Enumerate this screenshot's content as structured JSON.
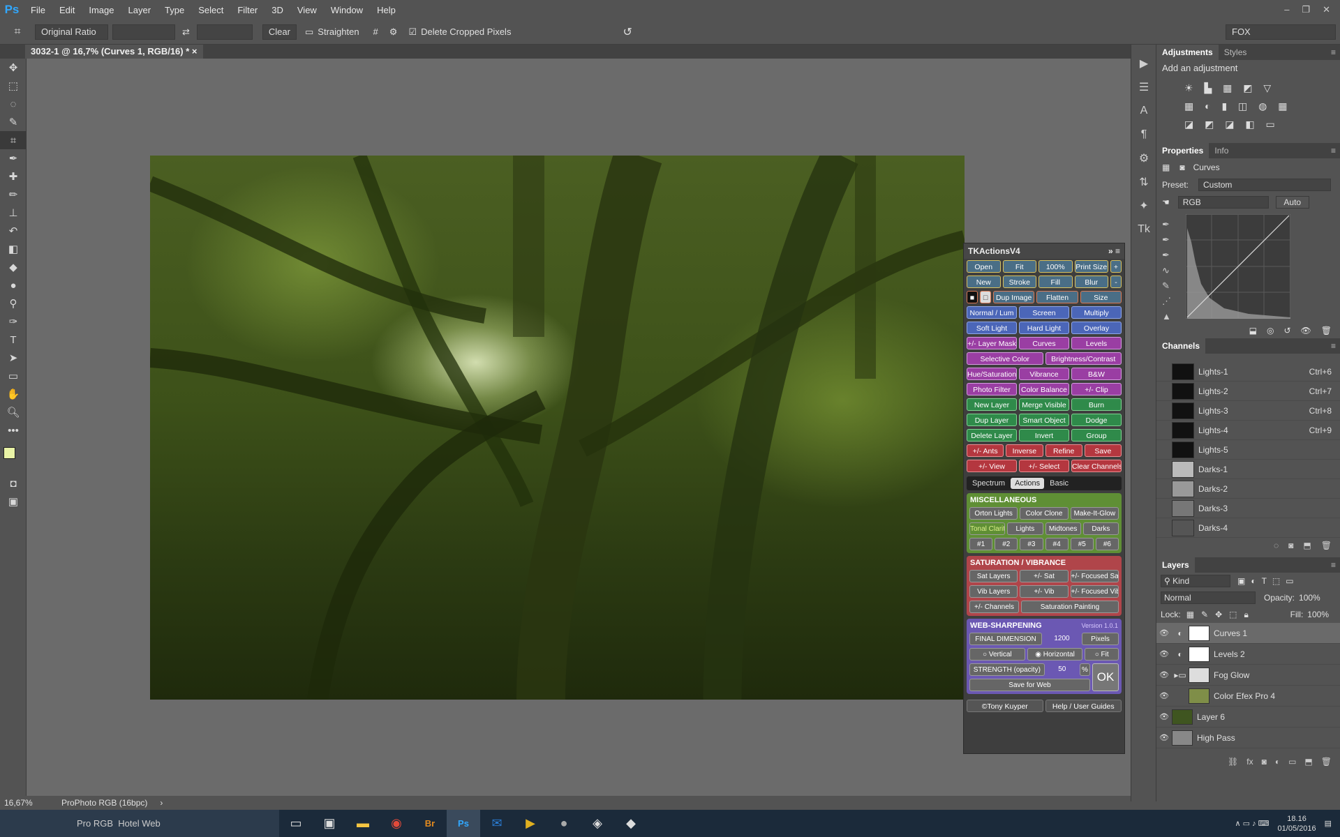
{
  "app": {
    "logo": "Ps"
  },
  "menu": [
    "File",
    "Edit",
    "Image",
    "Layer",
    "Type",
    "Select",
    "Filter",
    "3D",
    "View",
    "Window",
    "Help"
  ],
  "options": {
    "ratio": "Original Ratio",
    "clear": "Clear",
    "straighten": "Straighten",
    "delete_cropped": "Delete Cropped Pixels",
    "workspace": "FOX"
  },
  "document": {
    "tab": "3032-1 @ 16,7% (Curves 1, RGB/16) *",
    "zoom": "16,67%",
    "profile": "ProPhoto RGB (16bpc)"
  },
  "adjustments": {
    "tab1": "Adjustments",
    "tab2": "Styles",
    "hint": "Add an adjustment"
  },
  "properties": {
    "tab1": "Properties",
    "tab2": "Info",
    "type": "Curves",
    "preset_label": "Preset:",
    "preset": "Custom",
    "channel": "RGB",
    "auto": "Auto"
  },
  "channels": {
    "title": "Channels",
    "rows": [
      {
        "name": "Lights-1",
        "sc": "Ctrl+6"
      },
      {
        "name": "Lights-2",
        "sc": "Ctrl+7"
      },
      {
        "name": "Lights-3",
        "sc": "Ctrl+8"
      },
      {
        "name": "Lights-4",
        "sc": "Ctrl+9"
      },
      {
        "name": "Lights-5",
        "sc": ""
      },
      {
        "name": "Darks-1",
        "sc": ""
      },
      {
        "name": "Darks-2",
        "sc": ""
      },
      {
        "name": "Darks-3",
        "sc": ""
      },
      {
        "name": "Darks-4",
        "sc": ""
      }
    ]
  },
  "layers": {
    "title": "Layers",
    "kind": "Kind",
    "blend": "Normal",
    "opacity_label": "Opacity:",
    "opacity": "100%",
    "lock_label": "Lock:",
    "fill_label": "Fill:",
    "fill": "100%",
    "rows": [
      "Curves 1",
      "Levels 2",
      "Fog Glow",
      "Color Efex Pro 4",
      "Layer 6",
      "High Pass"
    ]
  },
  "tk": {
    "title": "TKActionsV4",
    "rows": [
      [
        "Open",
        "Fit",
        "100%",
        "Print Size",
        "+"
      ],
      [
        "New",
        "Stroke",
        "Fill",
        "Blur",
        "-"
      ],
      [
        "■",
        "□",
        "Dup Image",
        "Flatten",
        "Size"
      ],
      [
        "Normal / Lum",
        "Screen",
        "Multiply"
      ],
      [
        "Soft Light",
        "Hard Light",
        "Overlay"
      ],
      [
        "+/- Layer Mask",
        "Curves",
        "Levels"
      ],
      [
        "Selective Color",
        "Brightness/Contrast"
      ],
      [
        "Hue/Saturation",
        "Vibrance",
        "B&W"
      ],
      [
        "Photo Filter",
        "Color Balance",
        "+/- Clip"
      ],
      [
        "New Layer",
        "Merge Visible",
        "Burn"
      ],
      [
        "Dup Layer",
        "Smart Object",
        "Dodge"
      ],
      [
        "Delete Layer",
        "Invert",
        "Group"
      ],
      [
        "+/- Ants",
        "Inverse",
        "Refine",
        "Save"
      ],
      [
        "+/- View",
        "+/- Select",
        "Clear Channels"
      ]
    ],
    "tabs": [
      "Spectrum",
      "Actions",
      "Basic"
    ],
    "misc_title": "MISCELLANEOUS",
    "misc_rows": [
      [
        "Orton Lights",
        "Color Clone",
        "Make-It-Glow"
      ],
      [
        "Tonal Clarity",
        "Lights",
        "Midtones",
        "Darks"
      ],
      [
        "#1",
        "#2",
        "#3",
        "#4",
        "#5",
        "#6"
      ]
    ],
    "sat_title": "SATURATION / VIBRANCE",
    "sat_rows": [
      [
        "Sat Layers",
        "+/- Sat",
        "+/- Focused Sat"
      ],
      [
        "Vib Layers",
        "+/- Vib",
        "+/- Focused Vib"
      ],
      [
        "+/- Channels",
        "Saturation Painting"
      ]
    ],
    "web_title": "WEB-SHARPENING",
    "version": "Version 1.0.1",
    "final_dim": "FINAL DIMENSION",
    "dim_value": "1200",
    "pixels": "Pixels",
    "vertical": "Vertical",
    "horizontal": "Horizontal",
    "fit": "Fit",
    "strength": "STRENGTH (opacity)",
    "strength_value": "50",
    "pct": "%",
    "ok": "OK",
    "save_web": "Save for Web",
    "footer1": "©Tony Kuyper",
    "footer2": "Help / User Guides"
  },
  "taskbar": {
    "left_label": "Pro RGB",
    "left_title": "Hotel Web",
    "time": "18.16",
    "date": "01/05/2016"
  }
}
